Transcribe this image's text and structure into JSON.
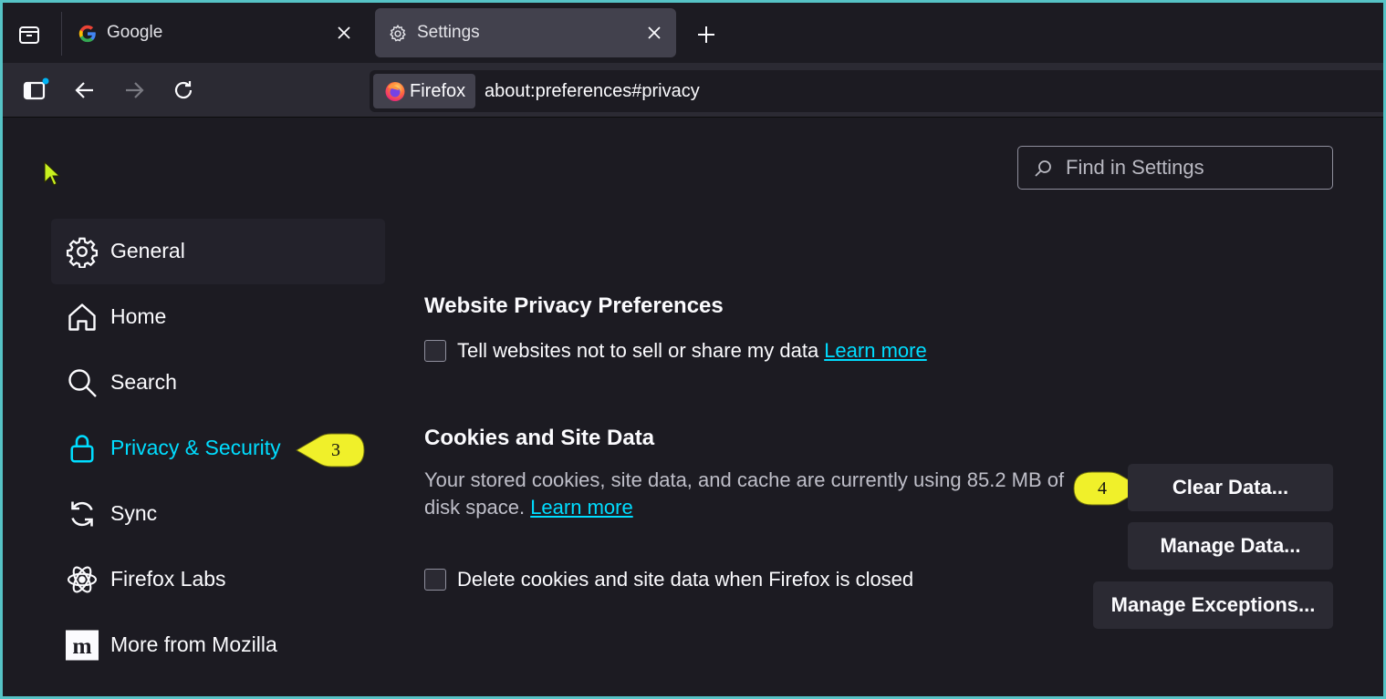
{
  "tabs": [
    {
      "title": "Google",
      "icon": "google-g-icon",
      "active": false
    },
    {
      "title": "Settings",
      "icon": "gear-icon",
      "active": true
    }
  ],
  "navbar": {
    "identity_label": "Firefox",
    "url": "about:preferences#privacy"
  },
  "search": {
    "placeholder": "Find in Settings"
  },
  "sidebar": {
    "items": [
      {
        "label": "General",
        "icon": "gear-icon"
      },
      {
        "label": "Home",
        "icon": "home-icon"
      },
      {
        "label": "Search",
        "icon": "search-icon"
      },
      {
        "label": "Privacy & Security",
        "icon": "lock-icon",
        "selected": true
      },
      {
        "label": "Sync",
        "icon": "sync-icon"
      },
      {
        "label": "Firefox Labs",
        "icon": "atom-icon"
      },
      {
        "label": "More from Mozilla",
        "icon": "mozilla-m-icon"
      }
    ]
  },
  "main": {
    "website_privacy": {
      "heading": "Website Privacy Preferences",
      "checkbox_label": "Tell websites not to sell or share my data",
      "learn_more": "Learn more"
    },
    "cookies": {
      "heading": "Cookies and Site Data",
      "description": "Your stored cookies, site data, and cache are currently using 85.2 MB of disk space.",
      "learn_more": "Learn more",
      "clear_button": "Clear Data...",
      "manage_button": "Manage Data...",
      "exceptions_button": "Manage Exceptions...",
      "delete_checkbox_label": "Delete cookies and site data when Firefox is closed"
    }
  },
  "callouts": {
    "step_privacy": "3",
    "step_clear": "4"
  },
  "colors": {
    "accent": "#00ddff",
    "background": "#1c1b22",
    "callout": "#f0f02a",
    "frame_border": "#56c3c6"
  }
}
